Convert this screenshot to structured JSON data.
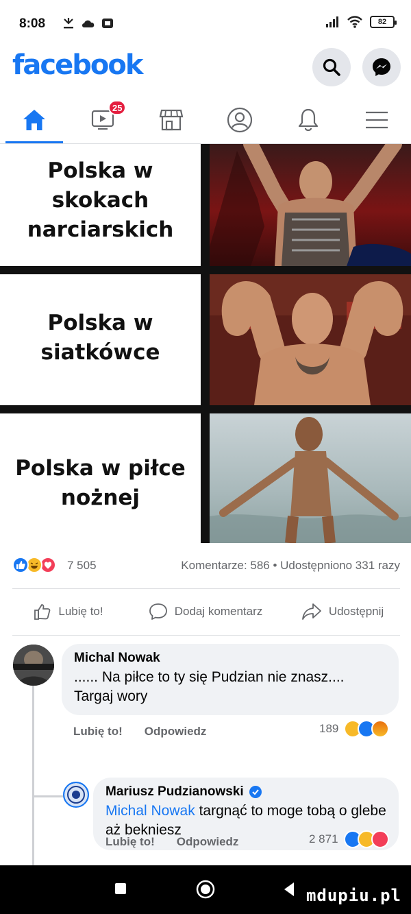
{
  "status_bar": {
    "time": "8:08",
    "battery": "82"
  },
  "header": {
    "brand": "facebook",
    "search_icon": "search-icon",
    "messenger_icon": "messenger-icon"
  },
  "nav": {
    "tabs": [
      {
        "name": "home",
        "icon": "home-icon",
        "active": true
      },
      {
        "name": "watch",
        "icon": "video-icon",
        "badge": "25"
      },
      {
        "name": "marketplace",
        "icon": "store-icon"
      },
      {
        "name": "profile",
        "icon": "profile-icon"
      },
      {
        "name": "notifications",
        "icon": "bell-icon"
      },
      {
        "name": "menu",
        "icon": "menu-icon"
      }
    ],
    "accent": "#1877f2"
  },
  "meme": {
    "rows": [
      {
        "text": "Polska w skokach narciarskich"
      },
      {
        "text": "Polska w siatkówce"
      },
      {
        "text": "Polska w piłce nożnej"
      }
    ]
  },
  "post_stats": {
    "reaction_count": "7 505",
    "summary": "Komentarze: 586 • Udostępniono 331 razy"
  },
  "actions": {
    "like": "Lubię to!",
    "comment": "Dodaj komentarz",
    "share": "Udostępnij"
  },
  "comments": [
    {
      "author": "Michal Nowak",
      "text": "...... Na piłce to ty się Pudzian nie znasz.... Targaj wory",
      "like_label": "Lubię to!",
      "reply_label": "Odpowiedz",
      "reaction_count": "189"
    },
    {
      "author": "Mariusz Pudzianowski",
      "verified": true,
      "mention": "Michal Nowak",
      "text": "targnąć to moge tobą o glebe aż bekniesz",
      "like_label": "Lubię to!",
      "reply_label": "Odpowiedz",
      "reaction_count": "2 871"
    }
  ],
  "watermark": "mdupiu.pl"
}
